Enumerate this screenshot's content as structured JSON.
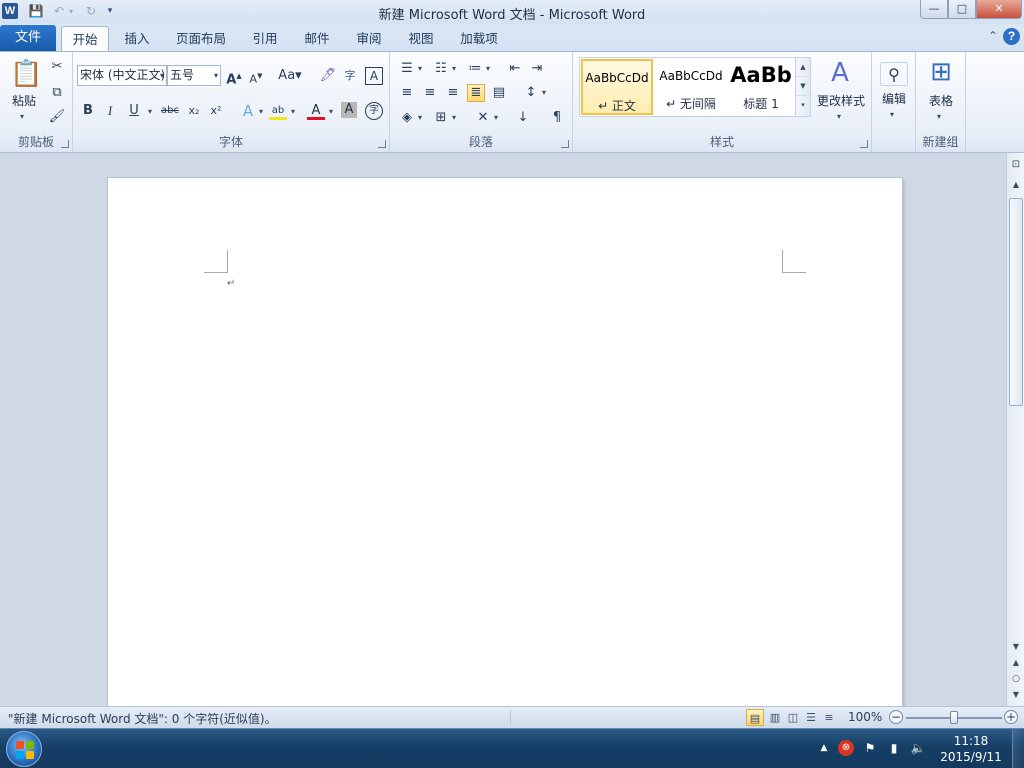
{
  "title_bar": {
    "app_icon_letter": "W",
    "title": "新建 Microsoft Word 文档 - Microsoft Word",
    "window_buttons": {
      "minimize": "—",
      "maximize": "□",
      "close": "✕"
    }
  },
  "quick_access": {
    "save_icon": "floppy-disk",
    "undo_icon": "undo-arrow",
    "redo_icon": "redo-arrow",
    "customize_icon": "chevron-down"
  },
  "tabs": {
    "file": "文件",
    "items": [
      "开始",
      "插入",
      "页面布局",
      "引用",
      "邮件",
      "审阅",
      "视图",
      "加载项"
    ],
    "active": "开始"
  },
  "ribbon": {
    "clipboard": {
      "label": "剪贴板",
      "paste": "粘贴"
    },
    "font": {
      "label": "字体",
      "font_name": "宋体 (中文正文)",
      "font_size": "五号"
    },
    "paragraph": {
      "label": "段落"
    },
    "styles": {
      "label": "样式",
      "items": [
        {
          "sample": "AaBbCcDd",
          "name": "↵ 正文"
        },
        {
          "sample": "AaBbCcDd",
          "name": "↵ 无间隔"
        },
        {
          "sample": "AaBb",
          "name": "标题 1"
        }
      ],
      "change_styles": "更改样式"
    },
    "editing": {
      "label": "编辑"
    },
    "table": {
      "label": "表格",
      "group_label": "新建组"
    }
  },
  "document": {
    "paragraph_mark": "↵"
  },
  "status_bar": {
    "text": "\"新建 Microsoft Word 文档\": 0 个字符(近似值)。",
    "zoom": "100%"
  },
  "taskbar": {
    "time": "11:18",
    "date": "2015/9/11"
  },
  "colors": {
    "file_tab": "#1a5aa9",
    "ribbon_bg": "#fbfcfe",
    "doc_bg": "#cfd8e5",
    "taskbar": "#163f66",
    "selected_style": "#f2c04c"
  }
}
